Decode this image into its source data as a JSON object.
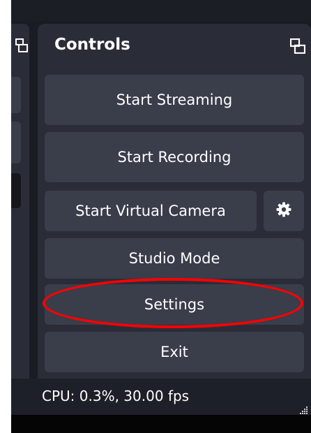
{
  "controls": {
    "title": "Controls",
    "buttons": {
      "start_streaming": "Start Streaming",
      "start_recording": "Start Recording",
      "start_virtual_camera": "Start Virtual Camera",
      "studio_mode": "Studio Mode",
      "settings": "Settings",
      "exit": "Exit"
    }
  },
  "status_bar": {
    "text": "CPU: 0.3%, 30.00 fps"
  },
  "colors": {
    "background": "#1a1c24",
    "dock": "#2a2d38",
    "button": "#3a3d4a",
    "text": "#ffffff",
    "highlight": "#ff0000"
  },
  "icons": {
    "undock": "undock-icon",
    "gear": "gear-icon",
    "resize": "resize-grip-icon"
  }
}
